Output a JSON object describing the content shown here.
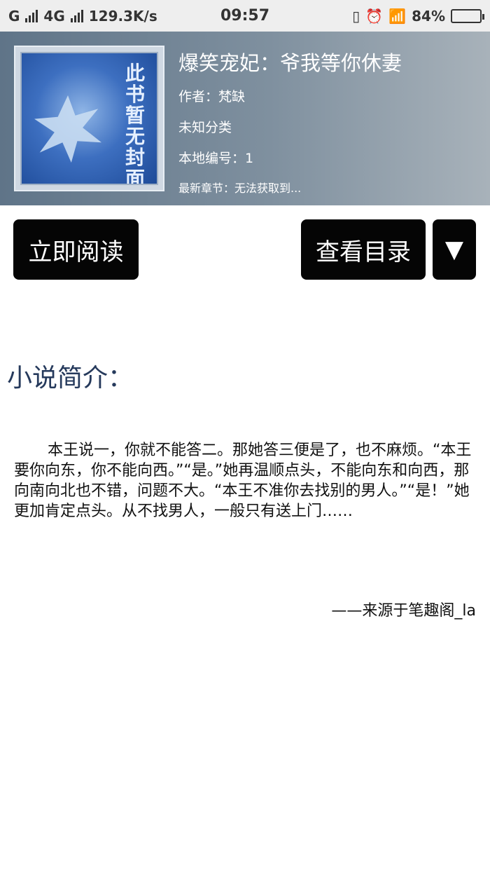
{
  "status_bar": {
    "carrier_1": "G",
    "carrier_2": "4G",
    "speed": "129.3K/s",
    "time": "09:57",
    "battery_percent": "84%",
    "battery_level": 0.84
  },
  "book": {
    "cover_text": "此书暂无封面",
    "title": "爆笑宠妃：爷我等你休妻",
    "author": "作者：梵缺",
    "category": "未知分类",
    "local_id": "本地编号：1",
    "latest_chapter": "最新章节：无法获取到..."
  },
  "actions": {
    "read_now": "立即阅读",
    "view_toc": "查看目录",
    "dropdown": "▼"
  },
  "intro": {
    "heading": "小说简介：",
    "text": "本王说一，你就不能答二。那她答三便是了，也不麻烦。“本王要你向东，你不能向西。”“是。”她再温顺点头，不能向东和向西，那向南向北也不错，问题不大。“本王不准你去找别的男人。”“是！”她更加肯定点头。从不找男人，一般只有送上门……",
    "source": "——来源于笔趣阁_la"
  }
}
